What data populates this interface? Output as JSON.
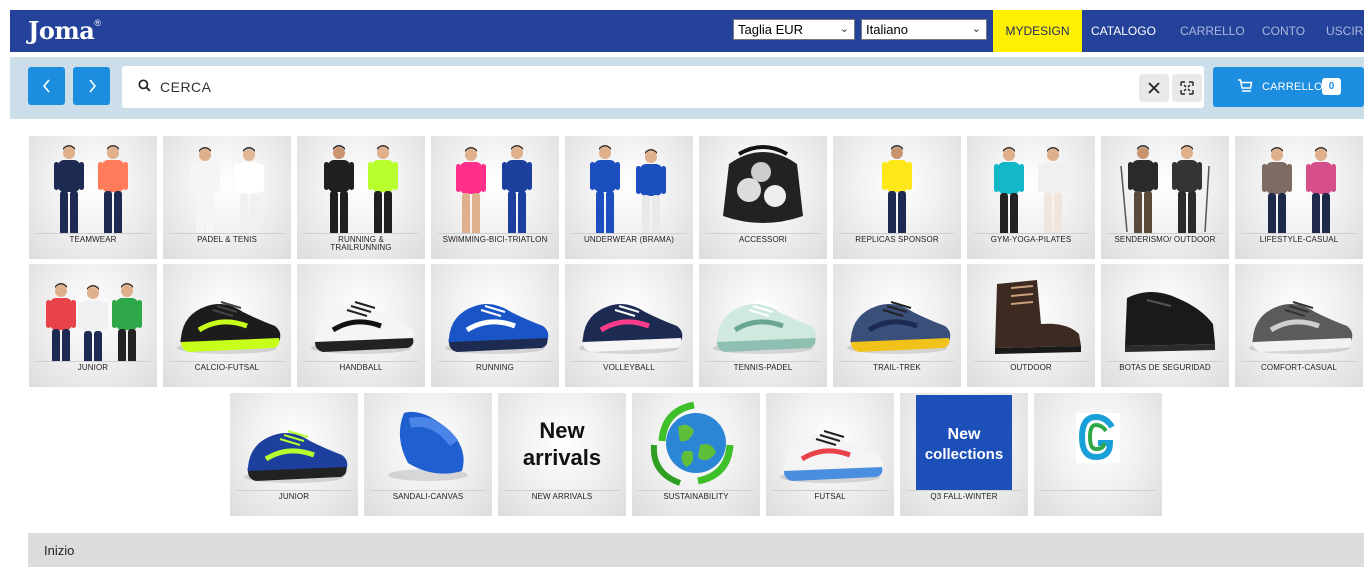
{
  "header": {
    "logo": "Joma",
    "logo_mark": "®",
    "size_select": "Taglia EUR",
    "language_select": "Italiano",
    "nav": {
      "mydesign": "MYDESIGN",
      "catalogo": "CATALOGO",
      "carrello": "CARRELLO",
      "conto": "CONTO",
      "uscire": "USCIRE"
    },
    "colors": {
      "bar": "#24429a",
      "mydesign": "#ffef00"
    }
  },
  "search": {
    "placeholder": "CERCA",
    "value": "",
    "back_icon": "chevron-left-icon",
    "forward_icon": "chevron-right-icon",
    "clear_icon": "close-icon",
    "fullscreen_icon": "expand-icon"
  },
  "cart": {
    "label": "CARRELLO",
    "count": "0",
    "icon": "cart-icon"
  },
  "categories": {
    "row1": [
      {
        "label": "TEAMWEAR",
        "icon": "two-athletes"
      },
      {
        "label": "PADEL & TENIS",
        "icon": "two-players"
      },
      {
        "label": "RUNNING &\nTRAILRUNNING",
        "icon": "two-runners"
      },
      {
        "label": "SWIMMING-BICI-TRIATLON",
        "icon": "two-swimmers"
      },
      {
        "label": "UNDERWEAR (BRAMA)",
        "icon": "two-models"
      },
      {
        "label": "ACCESSORI",
        "icon": "ball-bag"
      },
      {
        "label": "REPLICAS SPONSOR",
        "icon": "player-yellow"
      },
      {
        "label": "GYM-YOGA-PILATES",
        "icon": "two-fitness"
      },
      {
        "label": "SENDERISMO/ OUTDOOR",
        "icon": "two-hikers"
      },
      {
        "label": "LIFESTYLE-CASUAL",
        "icon": "two-casual"
      }
    ],
    "row2": [
      {
        "label": "JUNIOR",
        "icon": "three-kids"
      },
      {
        "label": "CALCIO-FUTSAL",
        "icon": "boot-black-yellow"
      },
      {
        "label": "HANDBALL",
        "icon": "shoe-white"
      },
      {
        "label": "RUNNING",
        "icon": "shoe-blue"
      },
      {
        "label": "VOLLEYBALL",
        "icon": "shoe-navy-pink"
      },
      {
        "label": "TENNIS-PADEL",
        "icon": "shoe-mint"
      },
      {
        "label": "TRAIL-TREK",
        "icon": "shoe-trail"
      },
      {
        "label": "OUTDOOR",
        "icon": "boot-brown"
      },
      {
        "label": "BOTAS DE SEGURIDAD",
        "icon": "boot-safety"
      },
      {
        "label": "COMFORT-CASUAL",
        "icon": "shoe-grey"
      }
    ],
    "row3": [
      {
        "label": "JUNIOR",
        "icon": "kids-shoe"
      },
      {
        "label": "SANDALI-CANVAS",
        "icon": "slide-sandal"
      },
      {
        "label": "NEW ARRIVALS",
        "icon": "new-arrivals-text",
        "art_text": [
          "New",
          "arrivals"
        ]
      },
      {
        "label": "SUSTAINABILITY",
        "icon": "globe-recycle"
      },
      {
        "label": "FUTSAL",
        "icon": "shoe-futsal"
      },
      {
        "label": "Q3 FALL-WINTER",
        "icon": "new-collections-text",
        "art_text": [
          "New",
          "collections"
        ]
      },
      {
        "label": "",
        "icon": "g-logo"
      }
    ]
  },
  "footer": {
    "breadcrumb": "Inizio"
  }
}
